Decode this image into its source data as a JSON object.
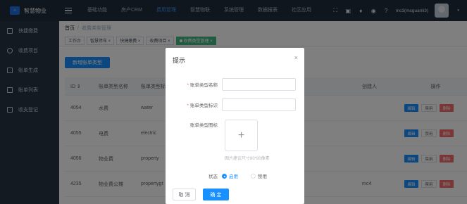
{
  "topbar": {
    "brand": "智慧物业",
    "nav": [
      "基础功能",
      "房产CRM",
      "费用管理",
      "智慧物联",
      "系统管理",
      "数据报表",
      "社区应用"
    ],
    "active_nav": "费用管理",
    "user": "mc3(mcguanli3)",
    "icons": [
      "fullscreen-icon",
      "message-icon",
      "bell-icon",
      "theme-icon",
      "help-icon"
    ]
  },
  "sidebar": {
    "items": [
      {
        "label": "快捷缴费",
        "icon": "card-icon"
      },
      {
        "label": "收费项目",
        "icon": "settings-icon"
      },
      {
        "label": "账单生成",
        "icon": "document-icon"
      },
      {
        "label": "账单列表",
        "icon": "list-icon"
      },
      {
        "label": "收支登记",
        "icon": "ledger-icon"
      }
    ]
  },
  "breadcrumb": {
    "home": "首页",
    "separator": "/",
    "current": "收费类型管理"
  },
  "tags": [
    "工作台",
    "智慧停车 ×",
    "快捷缴费 ×",
    "收费项目 ×",
    "收费类型管理 ×"
  ],
  "actions": {
    "add": "新增账单类型"
  },
  "table": {
    "headers": {
      "id": "ID ⇕",
      "name": "账单类型名称",
      "code": "账单类型标识",
      "creator": "创建人",
      "ops": "操作"
    },
    "rows": [
      {
        "id": "4054",
        "name": "水费",
        "code": "water",
        "creator": ""
      },
      {
        "id": "4055",
        "name": "电费",
        "code": "electric",
        "creator": ""
      },
      {
        "id": "4056",
        "name": "物业费",
        "code": "property",
        "creator": ""
      },
      {
        "id": "4235",
        "name": "物业费公摊",
        "code": "propertygt",
        "creator": "mc4"
      }
    ],
    "ops": {
      "edit": "编辑",
      "disable": "禁用",
      "delete": "删除"
    }
  },
  "dialog": {
    "title": "提示",
    "close": "×",
    "fields": {
      "name_label": "账单类型名称",
      "code_label": "账单类型标识",
      "icon_label": "账单类型图标",
      "name_value": "",
      "code_value": ""
    },
    "required_mark": "*",
    "upload_plus": "+",
    "upload_hint": "图片建议尺寸80*80像素",
    "status_label": "状态",
    "status_options": [
      "启用",
      "禁用"
    ],
    "status_selected": "启用",
    "cancel": "取 消",
    "confirm": "确 定"
  }
}
